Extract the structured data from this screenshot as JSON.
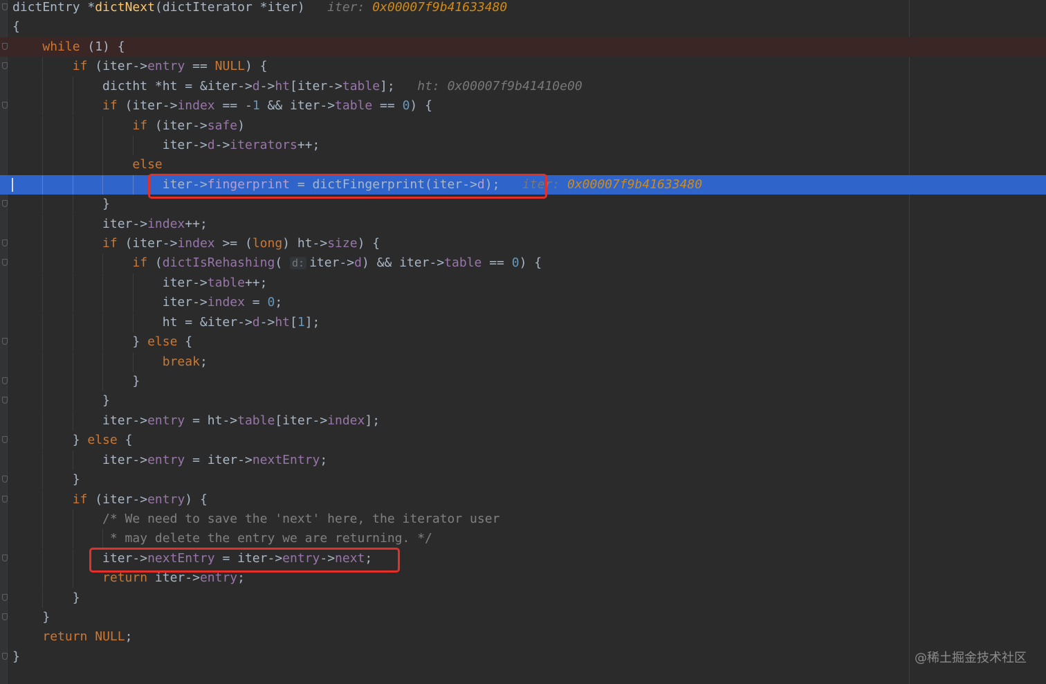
{
  "editor": {
    "lines": [
      [
        {
          "t": "dictEntry *"
        },
        {
          "t": "dictNext",
          "c": "fn"
        },
        {
          "t": "(dictIterator *iter)   "
        },
        {
          "t": "iter: ",
          "c": "hint-lbl"
        },
        {
          "t": "0x00007f9b41633480",
          "c": "hint-val"
        }
      ],
      [
        {
          "t": "{"
        }
      ],
      [
        {
          "t": "    "
        },
        {
          "t": "while",
          "c": "kw"
        },
        {
          "t": " (1) {"
        }
      ],
      [
        {
          "t": "        "
        },
        {
          "t": "if",
          "c": "kw"
        },
        {
          "t": " (iter->"
        },
        {
          "t": "entry",
          "c": "fld"
        },
        {
          "t": " == "
        },
        {
          "t": "NULL",
          "c": "kw"
        },
        {
          "t": ") {"
        }
      ],
      [
        {
          "t": "            dictht *ht = &iter->"
        },
        {
          "t": "d",
          "c": "fld"
        },
        {
          "t": "->"
        },
        {
          "t": "ht",
          "c": "fld"
        },
        {
          "t": "[iter->"
        },
        {
          "t": "table",
          "c": "fld"
        },
        {
          "t": "];  "
        },
        {
          "t": " ht: 0x00007f9b41410e00",
          "c": "hint-lbl"
        }
      ],
      [
        {
          "t": "            "
        },
        {
          "t": "if",
          "c": "kw"
        },
        {
          "t": " (iter->"
        },
        {
          "t": "index",
          "c": "fld"
        },
        {
          "t": " == -"
        },
        {
          "t": "1",
          "c": "num"
        },
        {
          "t": " && iter->"
        },
        {
          "t": "table",
          "c": "fld"
        },
        {
          "t": " == "
        },
        {
          "t": "0",
          "c": "num"
        },
        {
          "t": ") {"
        }
      ],
      [
        {
          "t": "                "
        },
        {
          "t": "if",
          "c": "kw"
        },
        {
          "t": " (iter->"
        },
        {
          "t": "safe",
          "c": "fld"
        },
        {
          "t": ")"
        }
      ],
      [
        {
          "t": "                    iter->"
        },
        {
          "t": "d",
          "c": "fld"
        },
        {
          "t": "->"
        },
        {
          "t": "iterators",
          "c": "fld"
        },
        {
          "t": "++;"
        }
      ],
      [
        {
          "t": "                "
        },
        {
          "t": "else",
          "c": "kw"
        }
      ],
      [
        {
          "t": "                    iter->"
        },
        {
          "t": "fingerprint",
          "c": "dim-fld"
        },
        {
          "t": " = dictFingerprint(iter->"
        },
        {
          "t": "d",
          "c": "dim-fld"
        },
        {
          "t": ");   "
        },
        {
          "t": "iter",
          "c": "hint-lbl"
        },
        {
          "t": ": ",
          "c": "hint-lbl"
        },
        {
          "t": "0x00007f9b41633480",
          "c": "hint-val"
        }
      ],
      [
        {
          "t": "            }"
        }
      ],
      [
        {
          "t": "            iter->"
        },
        {
          "t": "index",
          "c": "fld"
        },
        {
          "t": "++;"
        }
      ],
      [
        {
          "t": "            "
        },
        {
          "t": "if",
          "c": "kw"
        },
        {
          "t": " (iter->"
        },
        {
          "t": "index",
          "c": "fld"
        },
        {
          "t": " >= ("
        },
        {
          "t": "long",
          "c": "kw"
        },
        {
          "t": ") ht->"
        },
        {
          "t": "size",
          "c": "fld"
        },
        {
          "t": ") {"
        }
      ],
      [
        {
          "t": "                "
        },
        {
          "t": "if",
          "c": "kw"
        },
        {
          "t": " ("
        },
        {
          "t": "dictIsRehashing",
          "c": "fld"
        },
        {
          "t": "( "
        },
        {
          "t": "d:",
          "c": "param-hint"
        },
        {
          "t": "iter->"
        },
        {
          "t": "d",
          "c": "fld"
        },
        {
          "t": ") && iter->"
        },
        {
          "t": "table",
          "c": "fld"
        },
        {
          "t": " == "
        },
        {
          "t": "0",
          "c": "num"
        },
        {
          "t": ") {"
        }
      ],
      [
        {
          "t": "                    iter->"
        },
        {
          "t": "table",
          "c": "fld"
        },
        {
          "t": "++;"
        }
      ],
      [
        {
          "t": "                    iter->"
        },
        {
          "t": "index",
          "c": "fld"
        },
        {
          "t": " = "
        },
        {
          "t": "0",
          "c": "num"
        },
        {
          "t": ";"
        }
      ],
      [
        {
          "t": "                    ht = &iter->"
        },
        {
          "t": "d",
          "c": "fld"
        },
        {
          "t": "->"
        },
        {
          "t": "ht",
          "c": "fld"
        },
        {
          "t": "["
        },
        {
          "t": "1",
          "c": "num"
        },
        {
          "t": "];"
        }
      ],
      [
        {
          "t": "                } "
        },
        {
          "t": "else",
          "c": "kw"
        },
        {
          "t": " {"
        }
      ],
      [
        {
          "t": "                    "
        },
        {
          "t": "break",
          "c": "kw"
        },
        {
          "t": ";"
        }
      ],
      [
        {
          "t": "                }"
        }
      ],
      [
        {
          "t": "            }"
        }
      ],
      [
        {
          "t": "            iter->"
        },
        {
          "t": "entry",
          "c": "fld"
        },
        {
          "t": " = ht->"
        },
        {
          "t": "table",
          "c": "fld"
        },
        {
          "t": "[iter->"
        },
        {
          "t": "index",
          "c": "fld"
        },
        {
          "t": "];"
        }
      ],
      [
        {
          "t": "        } "
        },
        {
          "t": "else",
          "c": "kw"
        },
        {
          "t": " {"
        }
      ],
      [
        {
          "t": "            iter->"
        },
        {
          "t": "entry",
          "c": "fld"
        },
        {
          "t": " = iter->"
        },
        {
          "t": "nextEntry",
          "c": "fld"
        },
        {
          "t": ";"
        }
      ],
      [
        {
          "t": "        }"
        }
      ],
      [
        {
          "t": "        "
        },
        {
          "t": "if",
          "c": "kw"
        },
        {
          "t": " (iter->"
        },
        {
          "t": "entry",
          "c": "fld"
        },
        {
          "t": ") {"
        }
      ],
      [
        {
          "t": "            /* We need to save the 'next' here, the iterator user",
          "c": "cm"
        }
      ],
      [
        {
          "t": "             * may delete the entry we are returning. */",
          "c": "cm"
        }
      ],
      [
        {
          "t": "            iter->"
        },
        {
          "t": "nextEntry",
          "c": "fld"
        },
        {
          "t": " = iter->"
        },
        {
          "t": "entry",
          "c": "fld"
        },
        {
          "t": "->"
        },
        {
          "t": "next",
          "c": "fld"
        },
        {
          "t": ";"
        }
      ],
      [
        {
          "t": "            "
        },
        {
          "t": "return",
          "c": "kw"
        },
        {
          "t": " iter->"
        },
        {
          "t": "entry",
          "c": "fld"
        },
        {
          "t": ";"
        }
      ],
      [
        {
          "t": "        }"
        }
      ],
      [
        {
          "t": "    }"
        }
      ],
      [
        {
          "t": "    "
        },
        {
          "t": "return",
          "c": "kw"
        },
        {
          "t": " "
        },
        {
          "t": "NULL",
          "c": "kw"
        },
        {
          "t": ";"
        }
      ],
      [
        {
          "t": "}"
        }
      ]
    ],
    "breakpoint_line": 2,
    "execution_line": 9,
    "fold_lines": [
      0,
      2,
      3,
      5,
      10,
      12,
      13,
      17,
      19,
      20,
      22,
      24,
      25,
      28,
      30,
      31,
      33
    ],
    "highlighted_lines": [
      9,
      28
    ]
  },
  "watermark": "@稀土掘金技术社区",
  "colors": {
    "background": "#2b2b2b",
    "execution_line": "#2f65ca",
    "breakpoint_line": "#3b2626",
    "keyword": "#cc7832",
    "function": "#ffc66d",
    "field": "#9876aa",
    "number": "#6897bb",
    "comment": "#808080",
    "inline_hint_value": "#d28a12",
    "annotation_box": "#e0312a"
  }
}
